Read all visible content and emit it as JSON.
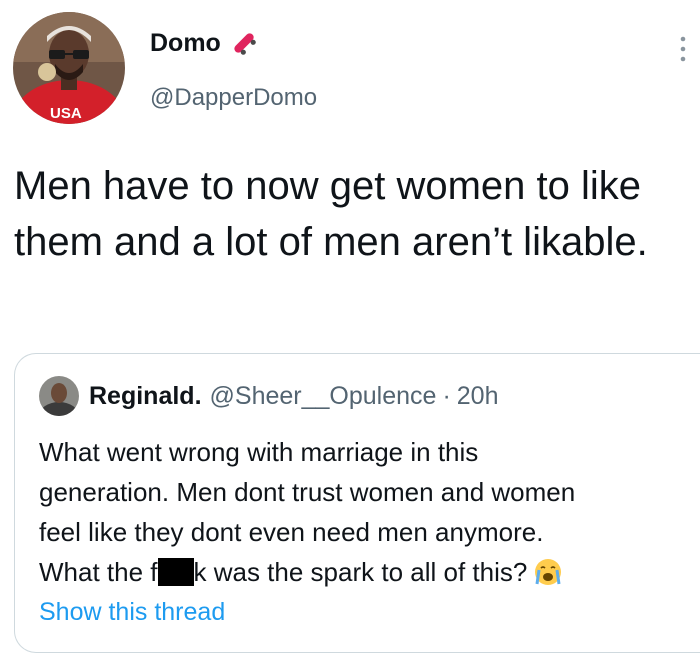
{
  "tweet": {
    "author_name": "Domo",
    "author_handle": "@DapperDomo",
    "name_icon": "skateboard-icon",
    "avatar_shirt_text": "USA",
    "menu_icon": "more-vertical-icon",
    "text": "Men have to now get women to like them and a lot of men aren’t likable."
  },
  "quote": {
    "author_name": "Reginald.",
    "author_handle": "@Sheer__Opulence",
    "separator": "·",
    "time": "20h",
    "lines": [
      "What went wrong with marriage in this",
      "generation. Men dont trust women and women",
      "feel like they dont even need men anymore."
    ],
    "last_line_before": "What the f",
    "last_line_after": "k was the spark to all of this?",
    "emoji_icon": "loudly-crying-face-icon",
    "show_thread": "Show this thread"
  },
  "colors": {
    "text": "#0f1419",
    "secondary": "#536471",
    "link": "#1d9bf0",
    "border": "#cfd9de"
  }
}
